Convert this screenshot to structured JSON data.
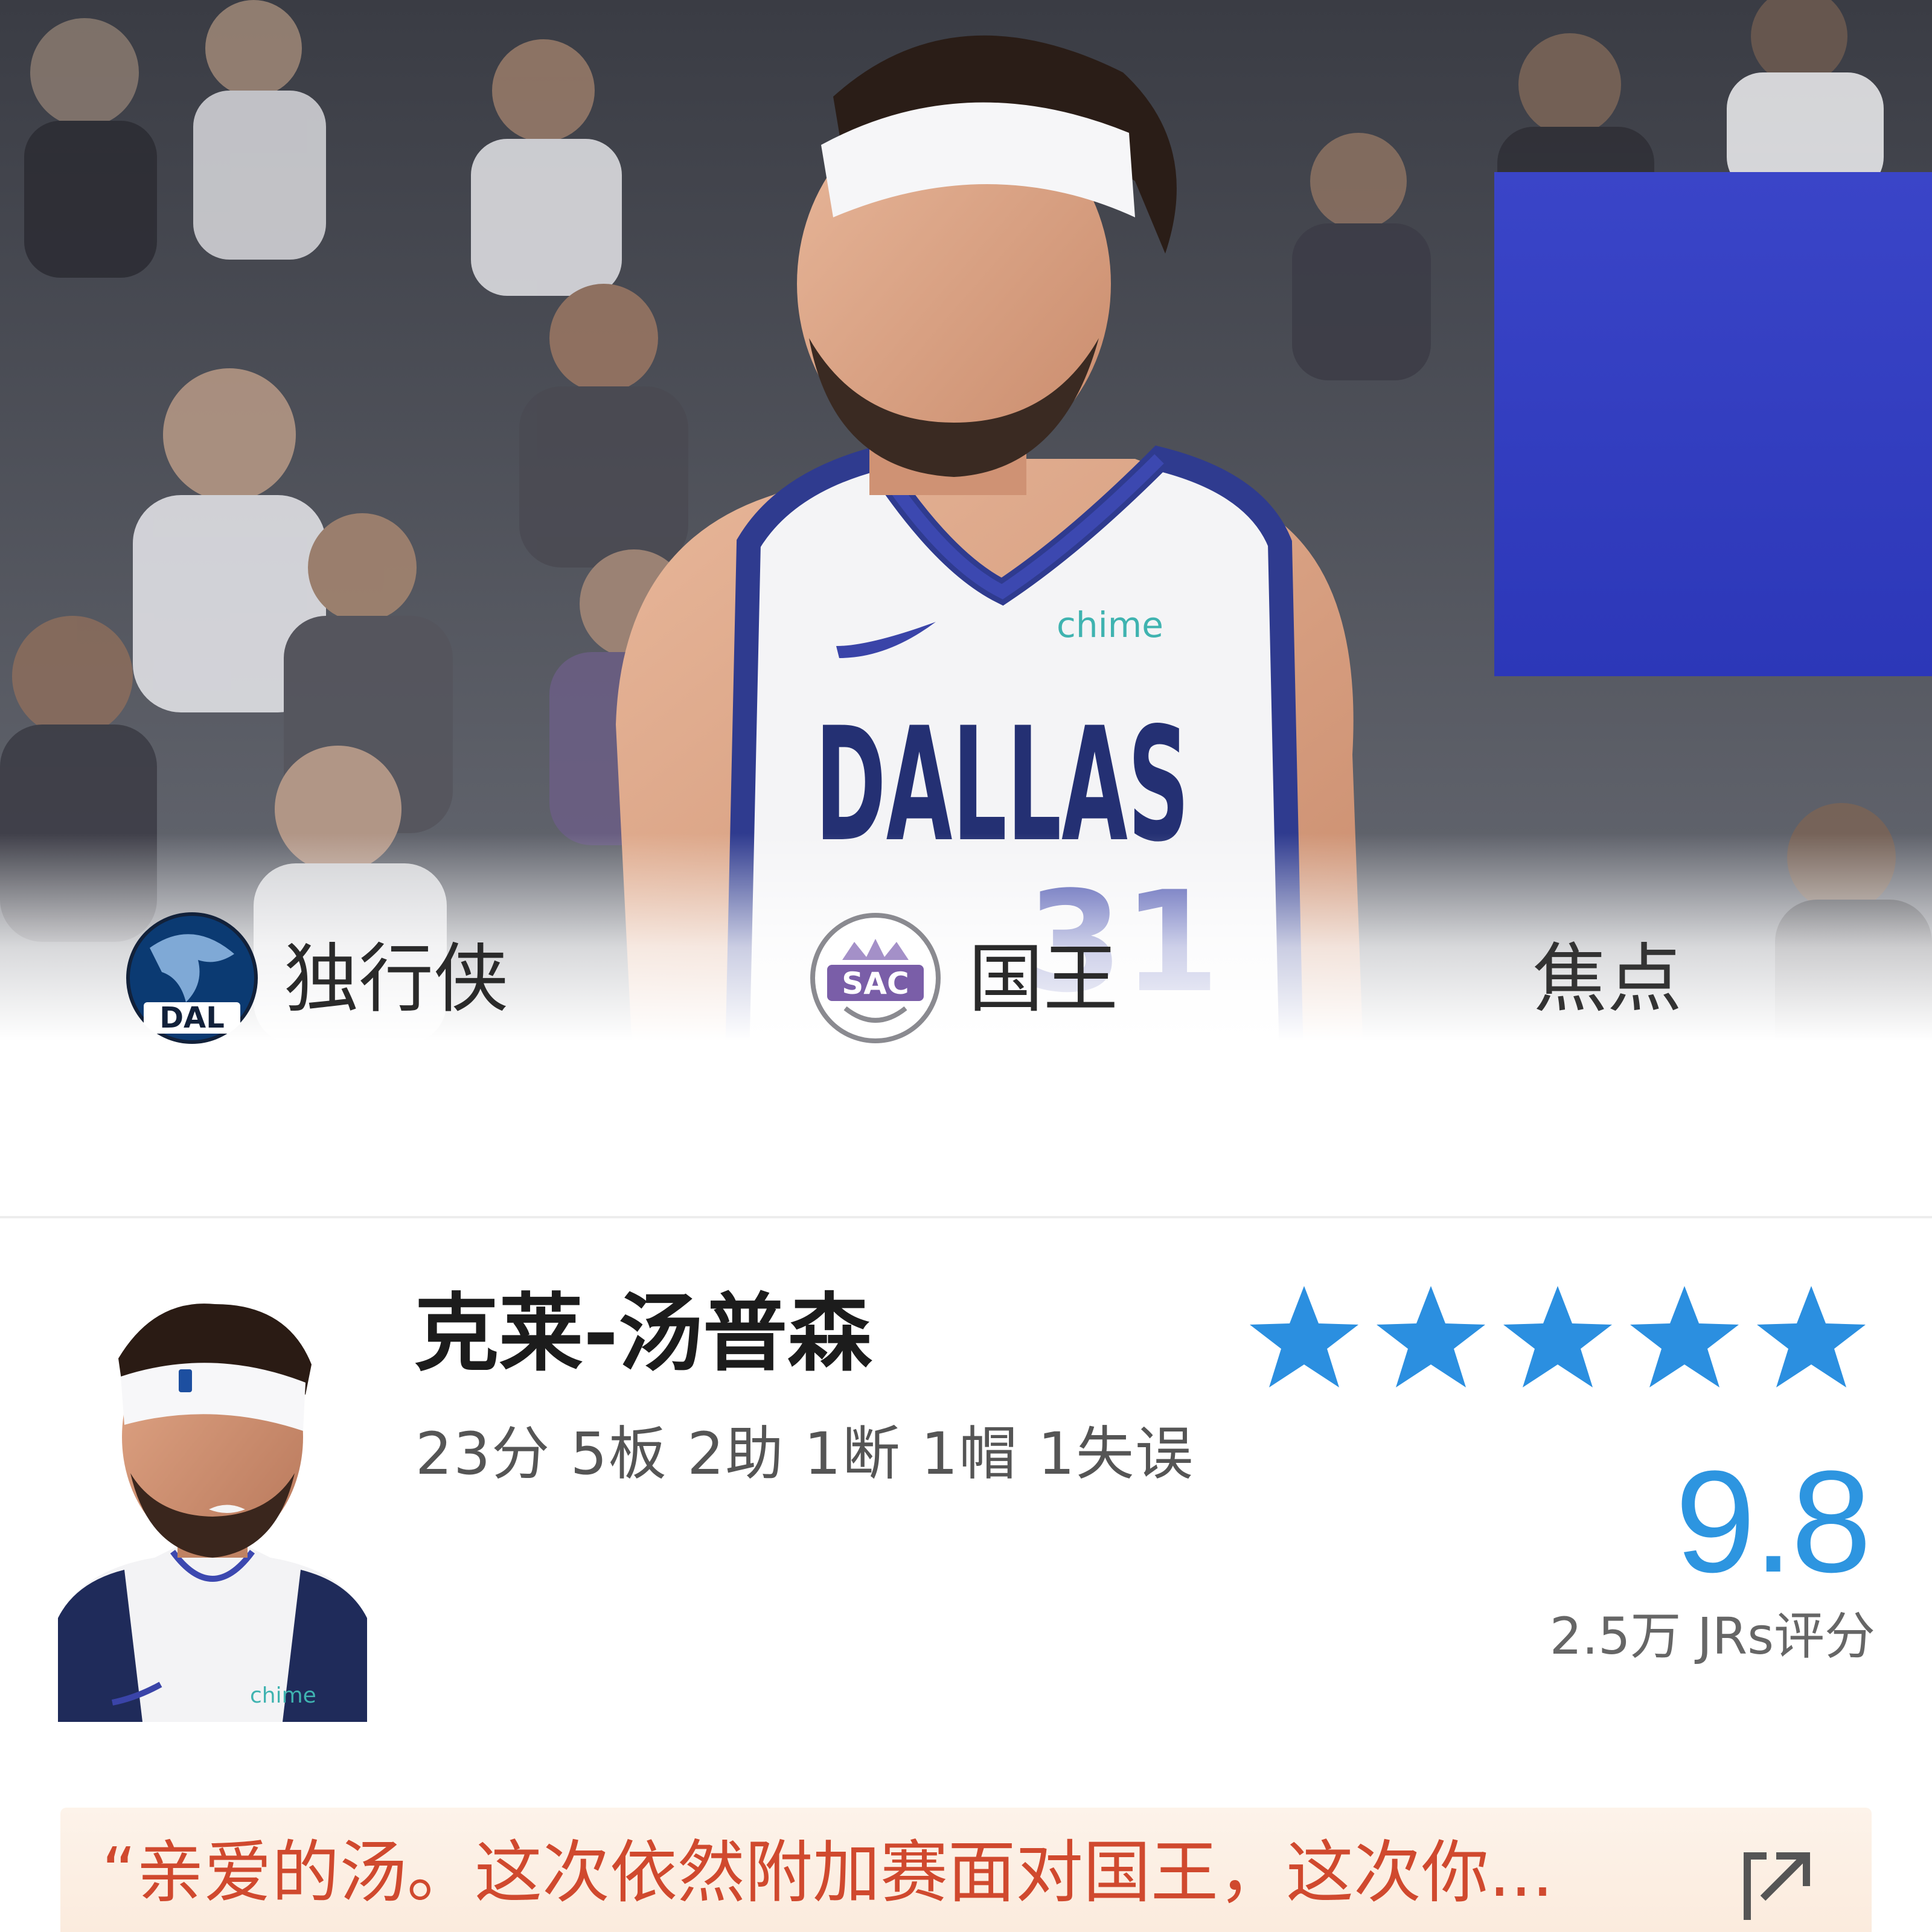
{
  "hero": {
    "jersey_text": "DALLAS",
    "jersey_number": "31",
    "jersey_sponsor": "chime",
    "tabs": [
      {
        "logo_text": "DAL",
        "label": "独行侠",
        "logo_color": "#0b3a72"
      },
      {
        "logo_text": "SAC",
        "label": "国王",
        "logo_color": "#7a5ea8"
      },
      {
        "label": "焦点"
      }
    ]
  },
  "player": {
    "name": "克莱-汤普森",
    "stats": "23分 5板 2助 1断 1帽 1失误",
    "rating_stars": 5,
    "rating_stars_max": 5,
    "score": "9.8",
    "raters": "2.5万 JRs评分",
    "avatar_sponsor": "chime"
  },
  "quote": {
    "text": "“亲爱的汤。这次依然附加赛面对国王，这次你..."
  },
  "colors": {
    "accent_blue": "#2d95e0",
    "star_blue": "#2b8fe0",
    "quote_red": "#d0492e",
    "quote_bg": "#fbefe3"
  },
  "icons": {
    "expand": "expand-arrow-icon"
  }
}
